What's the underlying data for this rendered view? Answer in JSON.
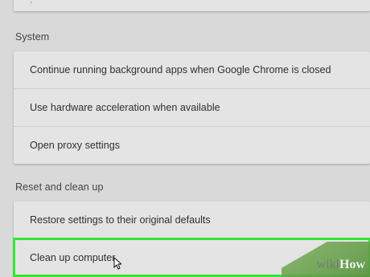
{
  "sections": {
    "system": {
      "header": "System",
      "rows": [
        {
          "label": "Continue running background apps when Google Chrome is closed"
        },
        {
          "label": "Use hardware acceleration when available"
        },
        {
          "label": "Open proxy settings"
        }
      ]
    },
    "reset": {
      "header": "Reset and clean up",
      "rows": [
        {
          "label": "Restore settings to their original defaults"
        },
        {
          "label": "Clean up computer"
        }
      ]
    }
  },
  "watermark": {
    "part1": "wiki",
    "part2": "How"
  },
  "colors": {
    "background": "#d9d9d9",
    "card": "#e4e4e4",
    "highlight": "#33e633"
  }
}
